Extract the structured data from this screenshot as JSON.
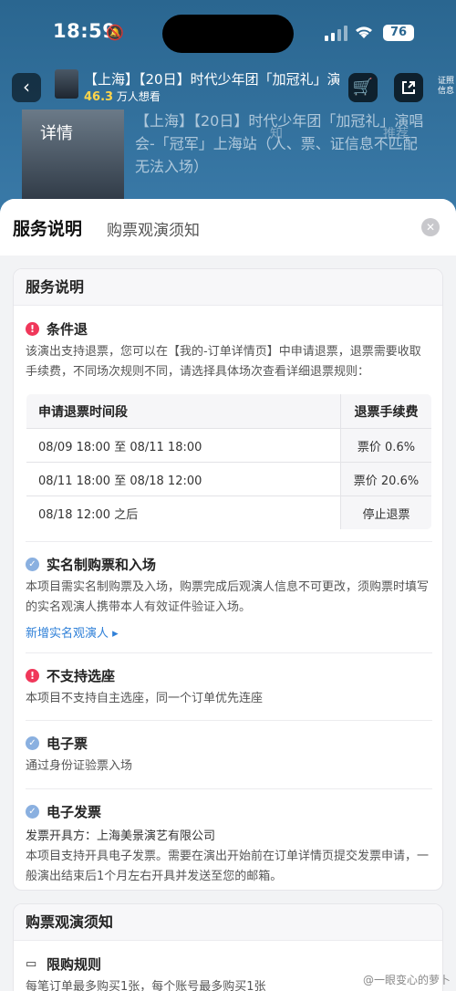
{
  "status_bar": {
    "time": "18:59",
    "battery": "76"
  },
  "header": {
    "title": "【上海】【20日】时代少年团「加冠礼」演...",
    "want_count": "46.3",
    "want_suffix": "万人想看",
    "cert_label": "证照信息"
  },
  "background": {
    "poster_text": "详情",
    "title": "【上海】【20日】时代少年团「加冠礼」演唱会-「冠军」上海站（人、票、证信息不匹配无法入场）",
    "ghost_1": "知",
    "ghost_2": "推荐"
  },
  "sheet": {
    "tabs": [
      "服务说明",
      "购票观演须知"
    ],
    "card1_title": "服务说明",
    "sections": {
      "refund": {
        "title": "条件退",
        "body": "该演出支持退票，您可以在【我的-订单详情页】中申请退票，退票需要收取手续费，不同场次规则不同，请选择具体场次查看详细退票规则：",
        "table": {
          "headers": [
            "申请退票时间段",
            "退票手续费"
          ],
          "rows": [
            [
              "08/09 18:00 至 08/11 18:00",
              "票价 0.6%"
            ],
            [
              "08/11 18:00 至 08/18 12:00",
              "票价 20.6%"
            ],
            [
              "08/18 12:00 之后",
              "停止退票"
            ]
          ]
        }
      },
      "realname": {
        "title": "实名制购票和入场",
        "body": "本项目需实名制购票及入场，购票完成后观演人信息不可更改，须购票时填写的实名观演人携带本人有效证件验证入场。",
        "link": "新增实名观演人 ▸"
      },
      "seat": {
        "title": "不支持选座",
        "body": "本项目不支持自主选座，同一个订单优先连座"
      },
      "eticket": {
        "title": "电子票",
        "body": "通过身份证验票入场"
      },
      "invoice": {
        "title": "电子发票",
        "issuer": "发票开具方：上海美景演艺有限公司",
        "body": "本项目支持开具电子发票。需要在演出开始前在订单详情页提交发票申请，一般演出结束后1个月左右开具并发送至您的邮箱。"
      }
    },
    "card2_title": "购票观演须知",
    "purchase_limit": {
      "title": "限购规则",
      "body": "每笔订单最多购买1张，每个账号最多购买1张"
    }
  },
  "watermark": "@一眼变心的萝卜"
}
